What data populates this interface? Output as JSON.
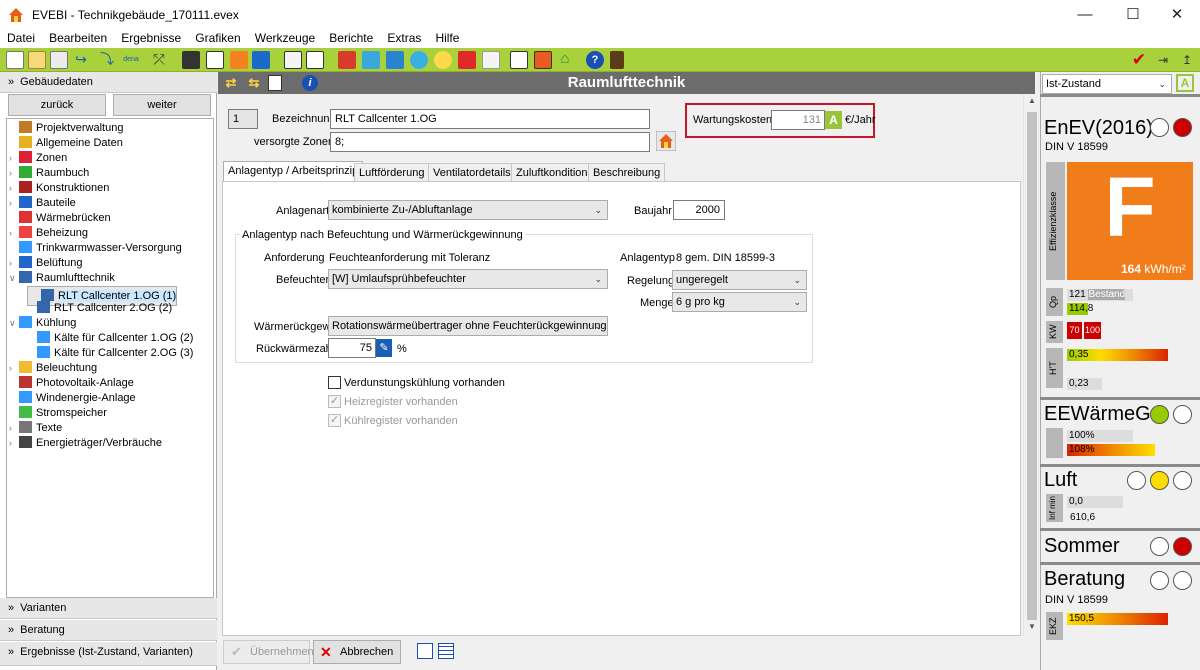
{
  "window": {
    "title": "EVEBI - Technikgebäude_170111.evex"
  },
  "menu": [
    "Datei",
    "Bearbeiten",
    "Ergebnisse",
    "Grafiken",
    "Werkzeuge",
    "Berichte",
    "Extras",
    "Hilfe"
  ],
  "toolbar_icons": [
    "new-icon",
    "open-icon",
    "copy-icon",
    "import-icon",
    "export-icon",
    "dena-icon",
    "wand-icon",
    "building-icon",
    "tree-icon",
    "arrow-orange-icon",
    "arrow-blue-icon",
    "structure-icon",
    "list-icon",
    "redbox-icon",
    "grid-icon",
    "search-icon",
    "fan-icon",
    "sun-icon",
    "power-icon",
    "doc-icon",
    "report-icon",
    "image-icon",
    "house-icon",
    "help-icon",
    "calc-icon"
  ],
  "left": {
    "header": "Gebäudedaten",
    "back": "zurück",
    "forward": "weiter",
    "tree": [
      {
        "label": "Projektverwaltung",
        "level": 0,
        "exp": "",
        "icon": "folder-gear-icon",
        "color": "#c07a28"
      },
      {
        "label": "Allgemeine Daten",
        "level": 0,
        "exp": "",
        "icon": "data-icon",
        "color": "#e6b020"
      },
      {
        "label": "Zonen",
        "level": 0,
        "exp": ">",
        "icon": "zone-icon",
        "color": "#d23"
      },
      {
        "label": "Raumbuch",
        "level": 0,
        "exp": ">",
        "icon": "room-icon",
        "color": "#3a3"
      },
      {
        "label": "Konstruktionen",
        "level": 0,
        "exp": ">",
        "icon": "construction-icon",
        "color": "#a22"
      },
      {
        "label": "Bauteile",
        "level": 0,
        "exp": ">",
        "icon": "component-icon",
        "color": "#26c"
      },
      {
        "label": "Wärmebrücken",
        "level": 0,
        "exp": "",
        "icon": "bridge-icon",
        "color": "#d33"
      },
      {
        "label": "Beheizung",
        "level": 0,
        "exp": ">",
        "icon": "heating-icon",
        "color": "#e44"
      },
      {
        "label": "Trinkwarmwasser-Versorgung",
        "level": 0,
        "exp": "",
        "icon": "water-icon",
        "color": "#39f"
      },
      {
        "label": "Belüftung",
        "level": 0,
        "exp": ">",
        "icon": "ventilation-icon",
        "color": "#26c"
      },
      {
        "label": "Raumlufttechnik",
        "level": 0,
        "exp": "v",
        "icon": "air-icon",
        "color": "#36a"
      },
      {
        "label": "RLT Callcenter 1.OG (1)",
        "level": 1,
        "exp": "",
        "icon": "air-unit-icon",
        "color": "#36a",
        "selected": true
      },
      {
        "label": "RLT Callcenter 2.OG (2)",
        "level": 1,
        "exp": "",
        "icon": "air-unit-icon",
        "color": "#36a"
      },
      {
        "label": "Kühlung",
        "level": 0,
        "exp": "v",
        "icon": "snowflake-icon",
        "color": "#39f"
      },
      {
        "label": "Kälte für Callcenter 1.OG (2)",
        "level": 1,
        "exp": "",
        "icon": "snowflake-icon",
        "color": "#39f"
      },
      {
        "label": "Kälte für Callcenter 2.OG (3)",
        "level": 1,
        "exp": "",
        "icon": "snowflake-icon",
        "color": "#39f"
      },
      {
        "label": "Beleuchtung",
        "level": 0,
        "exp": ">",
        "icon": "bulb-icon",
        "color": "#eb3"
      },
      {
        "label": "Photovoltaik-Anlage",
        "level": 0,
        "exp": "",
        "icon": "pv-icon",
        "color": "#b33"
      },
      {
        "label": "Windenergie-Anlage",
        "level": 0,
        "exp": "",
        "icon": "wind-icon",
        "color": "#39f"
      },
      {
        "label": "Stromspeicher",
        "level": 0,
        "exp": "",
        "icon": "battery-icon",
        "color": "#4b4"
      },
      {
        "label": "Texte",
        "level": 0,
        "exp": ">",
        "icon": "text-icon",
        "color": "#777"
      },
      {
        "label": "Energieträger/Verbräuche",
        "level": 0,
        "exp": ">",
        "icon": "energy-icon",
        "color": "#444"
      }
    ],
    "sections": [
      "Varianten",
      "Beratung",
      "Ergebnisse (Ist-Zustand, Varianten)"
    ]
  },
  "main": {
    "title": "Raumlufttechnik",
    "number": "1",
    "bezeichnung_label": "Bezeichnung",
    "bezeichnung": "RLT Callcenter 1.OG",
    "zonen_label": "versorgte Zonen",
    "zonen": "8;",
    "wartung_label": "Wartungskosten",
    "wartung_value": "131",
    "wartung_unit": "€/Jahr",
    "wartung_badge": "A",
    "tabs": [
      "Anlagentyp / Arbeitsprinzip",
      "Luftförderung",
      "Ventilatordetails",
      "Zuluftkondition",
      "Beschreibung"
    ],
    "anlagenart_label": "Anlagenart",
    "anlagenart": "kombinierte Zu-/Abluftanlage",
    "baujahr_label": "Baujahr",
    "baujahr": "2000",
    "group_title": "Anlagentyp nach Befeuchtung und Wärmerückgewinnung",
    "anforderung_label": "Anforderung",
    "anforderung": "Feuchteanforderung mit Toleranz",
    "anlagentyp_label": "Anlagentyp",
    "anlagentyp": "8 gem. DIN 18599-3",
    "befeuchter_label": "Befeuchter",
    "befeuchter": "[W] Umlaufsprühbefeuchter",
    "regelung_label": "Regelung",
    "regelung": "ungeregelt",
    "menge_label": "Menge",
    "menge": "6 g pro kg",
    "wrg_label": "Wärmerückgew.",
    "wrg": "Rotationswärmeübertrager ohne Feuchterückgewinnung",
    "rueck_label": "Rückwärmezahl",
    "rueck": "75",
    "rueck_unit": "%",
    "chk1": "Verdunstungskühlung vorhanden",
    "chk2": "Heizregister vorhanden",
    "chk3": "Kühlregister vorhanden",
    "apply": "Übernehmen",
    "cancel": "Abbrechen"
  },
  "right": {
    "state": "Ist-Zustand",
    "state_badge": "A",
    "enev": "EnEV(2016)",
    "din1": "DIN V 18599",
    "effizienz_label": "Effizienzklasse",
    "grade": "F",
    "kwh": "164",
    "kwh_unit": "kWh/m²",
    "qp_label": "Qp",
    "qp1": "121",
    "bestand": "Bestand",
    "qp2": "114,8",
    "kw_label": "KW",
    "kw1": "70",
    "kw2": "100",
    "ht_label": "H'T",
    "ht1": "0,35",
    "ht2": "0,23",
    "ee": "EEWärmeG",
    "ee1": "100%",
    "ee2": "108%",
    "luft": "Luft",
    "inf_label": "Inf min",
    "luft1": "0,0",
    "luft2": "610,6",
    "sommer": "Sommer",
    "beratung": "Beratung",
    "din2": "DIN V 18599",
    "ekz_label": "EKZ",
    "ekz": "150,5"
  },
  "colors": {
    "toolbar_green": "#a9d13c",
    "grade_orange": "#f07c1a",
    "red_light": "#cc0000",
    "green_light": "#99cc00",
    "yellow_light": "#ffdd00"
  }
}
